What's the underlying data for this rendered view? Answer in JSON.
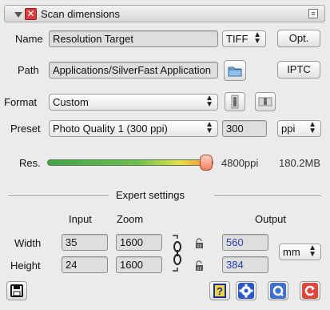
{
  "title_bar": {
    "title": "Scan dimensions"
  },
  "name_row": {
    "label": "Name",
    "value": "Resolution Target",
    "format": "TIFF",
    "opt_label": "Opt."
  },
  "path_row": {
    "label": "Path",
    "value": "Applications/SilverFast Application",
    "iptc_label": "IPTC"
  },
  "format_row": {
    "label": "Format",
    "value": "Custom"
  },
  "preset_row": {
    "label": "Preset",
    "value": "Photo Quality 1 (300 ppi)",
    "resolution": "300",
    "unit": "ppi"
  },
  "resolution_row": {
    "label": "Res.",
    "ppi": "4800ppi",
    "size": "180.2MB",
    "slider_fraction": 0.93
  },
  "expert": {
    "title": "Expert settings",
    "col_input": "Input",
    "col_zoom": "Zoom",
    "col_output": "Output",
    "width_label": "Width",
    "height_label": "Height",
    "width_input": "35",
    "width_zoom": "1600",
    "width_output": "560",
    "height_input": "24",
    "height_zoom": "1600",
    "height_output": "384",
    "output_unit": "mm"
  },
  "colors": {
    "accent_blue": "#2a3fb5",
    "slider_knob": "#f07e60"
  }
}
